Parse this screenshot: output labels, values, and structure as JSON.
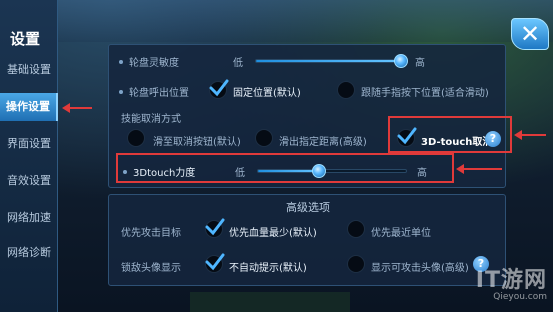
{
  "sidebar": {
    "title": "设置",
    "items": [
      "基础设置",
      "操作设置",
      "界面设置",
      "音效设置",
      "网络加速",
      "网络诊断"
    ],
    "active_index": 1
  },
  "close_label": "✕",
  "settings": {
    "wheel_sensitivity": {
      "label": "轮盘灵敏度",
      "low": "低",
      "high": "高",
      "value": 0.96
    },
    "wheel_callout": {
      "label": "轮盘呼出位置",
      "options": [
        "固定位置(默认)",
        "跟随手指按下位置(适合滑动)"
      ],
      "selected": 0
    },
    "skill_cancel": {
      "label": "技能取消方式",
      "options": [
        "滑至取消按钮(默认)",
        "滑出指定距离(高级)",
        "3D-touch取消"
      ],
      "selected": 2
    },
    "touch_force": {
      "label": "3Dtouch力度",
      "low": "低",
      "high": "高",
      "value": 0.41
    }
  },
  "advanced": {
    "title": "高级选项",
    "priority": {
      "label": "优先攻击目标",
      "options": [
        "优先血量最少(默认)",
        "优先最近单位"
      ],
      "selected": 0
    },
    "lock_avatar": {
      "label": "锁敌头像显示",
      "options": [
        "不自动提示(默认)",
        "显示可攻击头像(高级)"
      ],
      "selected": 0
    }
  },
  "watermark": {
    "main": "IT游网",
    "sub": "Qieyou.com"
  },
  "colors": {
    "accent": "#4aa7e6",
    "annotation": "#e03a3a"
  }
}
